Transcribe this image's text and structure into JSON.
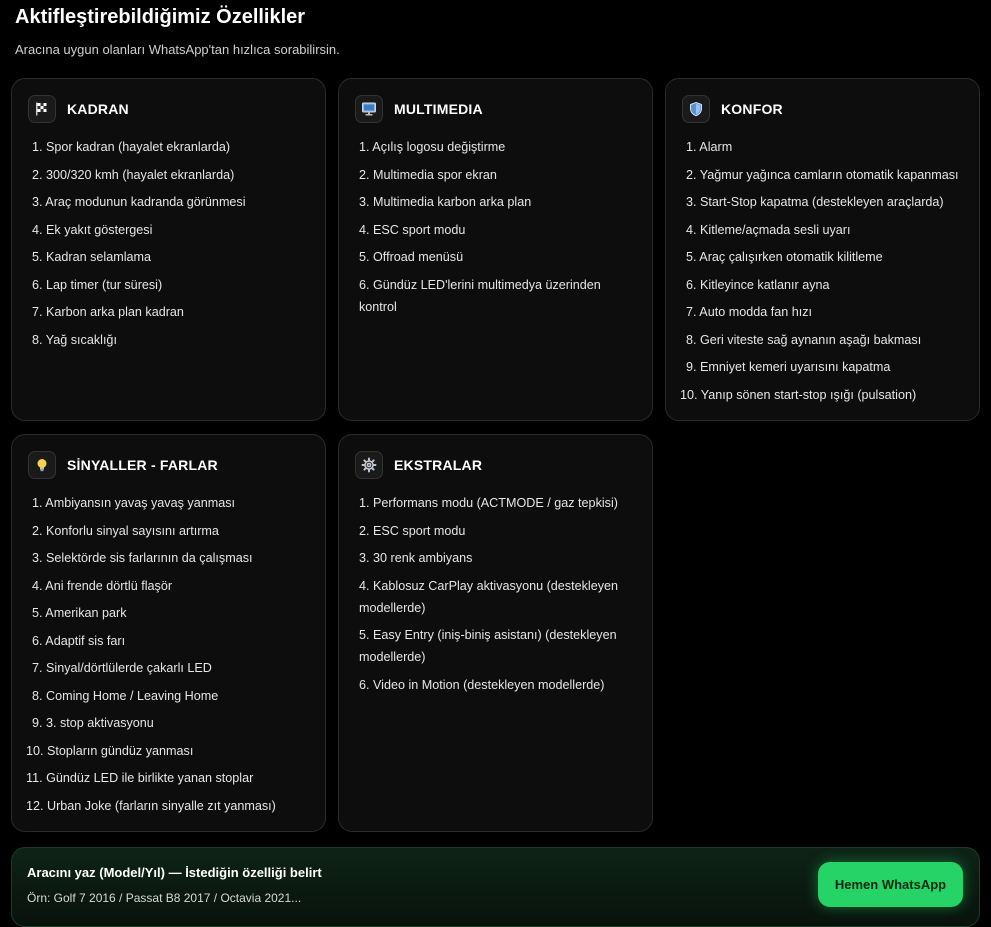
{
  "header": {
    "title": "Aktifleştirebildiğimiz Özellikler",
    "subtitle": "Aracına uygun olanları WhatsApp'tan hızlıca sorabilirsin."
  },
  "cards": [
    {
      "title": "KADRAN",
      "icon": "checkered-flag-icon",
      "items": [
        "1. Spor kadran (hayalet ekranlarda)",
        "2. 300/320 kmh (hayalet ekranlarda)",
        "3. Araç modunun kadranda görünmesi",
        "4. Ek yakıt göstergesi",
        "5. Kadran selamlama",
        "6. Lap timer (tur süresi)",
        "7. Karbon arka plan kadran",
        "8. Yağ sıcaklığı"
      ]
    },
    {
      "title": "MULTIMEDIA",
      "icon": "monitor-icon",
      "items": [
        "1. Açılış logosu değiştirme",
        "2. Multimedia spor ekran",
        "3. Multimedia karbon arka plan",
        "4. ESC sport modu",
        "5. Offroad menüsü",
        "6. Gündüz LED'lerini multimedya üzerinden kontrol"
      ]
    },
    {
      "title": "KONFOR",
      "icon": "shield-icon",
      "items": [
        "1. Alarm",
        "2. Yağmur yağınca camların otomatik kapanması",
        "3. Start-Stop kapatma (destekleyen araçlarda)",
        "4. Kitleme/açmada sesli uyarı",
        "5. Araç çalışırken otomatik kilitleme",
        "6. Kitleyince katlanır ayna",
        "7. Auto modda fan hızı",
        "8. Geri viteste sağ aynanın aşağı bakması",
        "9. Emniyet kemeri uyarısını kapatma",
        "10. Yanıp sönen start-stop ışığı (pulsation)"
      ]
    },
    {
      "title": "SİNYALLER - FARLAR",
      "icon": "light-bulb-icon",
      "items": [
        "1. Ambiyansın yavaş yavaş yanması",
        "2. Konforlu sinyal sayısını artırma",
        "3. Selektörde sis farlarının da çalışması",
        "4. Ani frende dörtlü flaşör",
        "5. Amerikan park",
        "6. Adaptif sis farı",
        "7. Sinyal/dörtlülerde çakarlı LED",
        "8. Coming Home / Leaving Home",
        "9. 3. stop aktivasyonu",
        "10. Stopların gündüz yanması",
        "11. Gündüz LED ile birlikte yanan stoplar",
        "12. Urban Joke (farların sinyalle zıt yanması)"
      ]
    },
    {
      "title": "EKSTRALAR",
      "icon": "gear-icon",
      "items": [
        "1. Performans modu (ACTMODE / gaz tepkisi)",
        "2. ESC sport modu",
        "3. 30 renk ambiyans",
        "4. Kablosuz CarPlay aktivasyonu (destekleyen modellerde)",
        "5. Easy Entry (iniş-biniş asistanı) (destekleyen modellerde)",
        "6. Video in Motion (destekleyen modellerde)"
      ]
    }
  ],
  "cta": {
    "line1": "Aracını yaz (Model/Yıl) — İstediğin özelliği belirt",
    "line2": "Örn: Golf 7 2016 / Passat B8 2017 / Octavia 2021...",
    "button": "Hemen WhatsApp"
  },
  "colors": {
    "background": "#000000",
    "card": "#0d0d0d",
    "whatsapp_green": "#25d366"
  }
}
